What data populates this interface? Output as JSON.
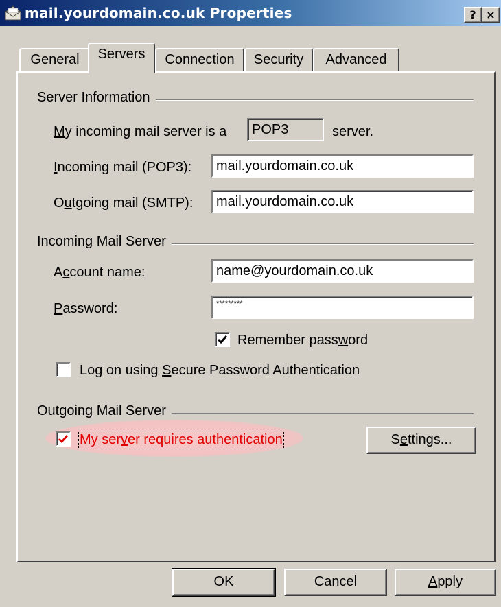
{
  "window": {
    "title": "mail.yourdomain.co.uk Properties",
    "help_button": "?",
    "close_button": "×"
  },
  "tabs": [
    {
      "label": "General",
      "active": false
    },
    {
      "label": "Servers",
      "active": true
    },
    {
      "label": "Connection",
      "active": false
    },
    {
      "label": "Security",
      "active": false
    },
    {
      "label": "Advanced",
      "active": false
    }
  ],
  "server_info": {
    "heading": "Server Information",
    "incoming_type_prefix_u": "M",
    "incoming_type_prefix": "y incoming mail server is a",
    "incoming_type_value": "POP3",
    "incoming_type_suffix": "server.",
    "incoming_mail_label_u": "I",
    "incoming_mail_label": "ncoming mail (POP3):",
    "incoming_mail_value": "mail.yourdomain.co.uk",
    "outgoing_mail_label_pre": "O",
    "outgoing_mail_label_u": "u",
    "outgoing_mail_label": "tgoing mail (SMTP):",
    "outgoing_mail_value": "mail.yourdomain.co.uk"
  },
  "incoming_server": {
    "heading": "Incoming Mail Server",
    "account_label_pre": "A",
    "account_label_u": "c",
    "account_label": "count name:",
    "account_value": "name@yourdomain.co.uk",
    "password_label_u": "P",
    "password_label": "assword:",
    "password_value": "*********",
    "remember_pre": "Remember pass",
    "remember_u": "w",
    "remember_post": "ord",
    "remember_checked": true,
    "spa_pre": "Log on using ",
    "spa_u": "S",
    "spa_post": "ecure Password Authentication",
    "spa_checked": false
  },
  "outgoing_server": {
    "heading": "Outgoing Mail Server",
    "auth_pre": "My ser",
    "auth_u": "v",
    "auth_post": "er requires authentication",
    "auth_checked": true,
    "settings_pre": "S",
    "settings_u": "e",
    "settings_post": "ttings..."
  },
  "footer": {
    "ok": "OK",
    "cancel": "Cancel",
    "apply_u": "A",
    "apply": "pply"
  },
  "colors": {
    "highlight_text": "#e00000",
    "highlight_glow": "#f4c2c2",
    "face": "#d4d0c8"
  }
}
